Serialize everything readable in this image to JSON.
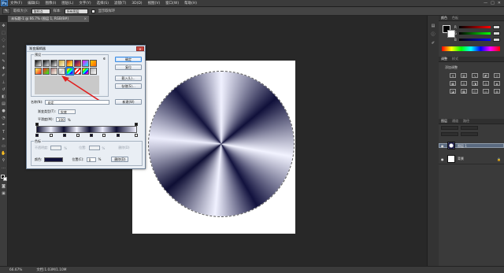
{
  "app": {
    "logo": "Ps"
  },
  "menu": [
    "文件(F)",
    "编辑(E)",
    "图像(I)",
    "图层(L)",
    "文字(Y)",
    "选择(S)",
    "滤镜(T)",
    "3D(D)",
    "视图(V)",
    "窗口(W)",
    "帮助(H)"
  ],
  "window_controls": [
    "—",
    "□",
    "✕"
  ],
  "options": {
    "size_label": "取样大小:",
    "size_value": "取样点",
    "sample_label": "样本:",
    "sample_value": "所有图层",
    "ring_label": "显示取样环"
  },
  "document": {
    "tab": "未标题-1 @ 66.7% (图层 1, RGB/8#)",
    "close": "×"
  },
  "status": {
    "zoom": "66.67%",
    "doc": "文档:1.03M/1.10M"
  },
  "right_panel": {
    "color_tabs": [
      "颜色",
      "色板"
    ],
    "channels": [
      "R",
      "G",
      "B"
    ],
    "adjust_tabs": [
      "调整",
      "样式"
    ],
    "adjust_title": "添加调整",
    "layers_tabs": [
      "图层",
      "通道",
      "路径"
    ],
    "layers": [
      {
        "name": "图层 1",
        "selected": true
      },
      {
        "name": "背景",
        "selected": false
      }
    ],
    "eye_icon": "●",
    "lock_icon": "🔒",
    "foot_icons": [
      "∞",
      "fx",
      "◘",
      "◐",
      "▭",
      "▣",
      "🗑"
    ]
  },
  "dialog": {
    "title": "渐变编辑器",
    "close": "✕",
    "presets_label": "预设",
    "buttons": {
      "ok": "确定",
      "reset": "复位",
      "load": "载入(L)...",
      "save": "存储(S)..."
    },
    "name_label": "名称(N):",
    "name_value": "自定",
    "new_button": "新建(W)",
    "type_label": "渐变类型(T):",
    "type_value": "实底",
    "smooth_label": "平滑度(M):",
    "smooth_value": "100",
    "smooth_unit": "%",
    "stops_label": "色标",
    "opacity_label": "不透明度:",
    "opacity_unit": "%",
    "position_label": "位置:",
    "position_unit": "%",
    "delete_label": "删除(D)",
    "color_label": "颜色:",
    "color_position_label": "位置(C):",
    "color_position_value": "0",
    "color_position_unit": "%",
    "color_delete_label": "删除(D)",
    "swatches": [
      "linear-gradient(135deg,#000,#fff)",
      "linear-gradient(135deg,#000,transparent)",
      "linear-gradient(135deg,#000,#fff)",
      "linear-gradient(135deg,#c4a43a,#fff7d2)",
      "linear-gradient(135deg,#b32,#fa2,#ff5)",
      "linear-gradient(135deg,#330066,#ff6633)",
      "linear-gradient(135deg,#f0f,#0ff)",
      "linear-gradient(135deg,#fc0,#f60)",
      "linear-gradient(135deg,#ff5,#e22)",
      "linear-gradient(135deg,#f22,#2f2)",
      "linear-gradient(135deg,#a77,#ffe)",
      "linear-gradient(135deg,#fff,#ccc,#fff)",
      "linear-gradient(135deg,#f00,#ff0,#0f0,#0ff,#00f,#f0f)",
      "repeating-linear-gradient(135deg,#f00 0 2px,#fff 2px 4px)",
      "linear-gradient(135deg,#f00,#ff0,#0f0,#0ff,#00f,#f0f,#f00)",
      "linear-gradient(135deg,#aaa,#fff)"
    ]
  }
}
